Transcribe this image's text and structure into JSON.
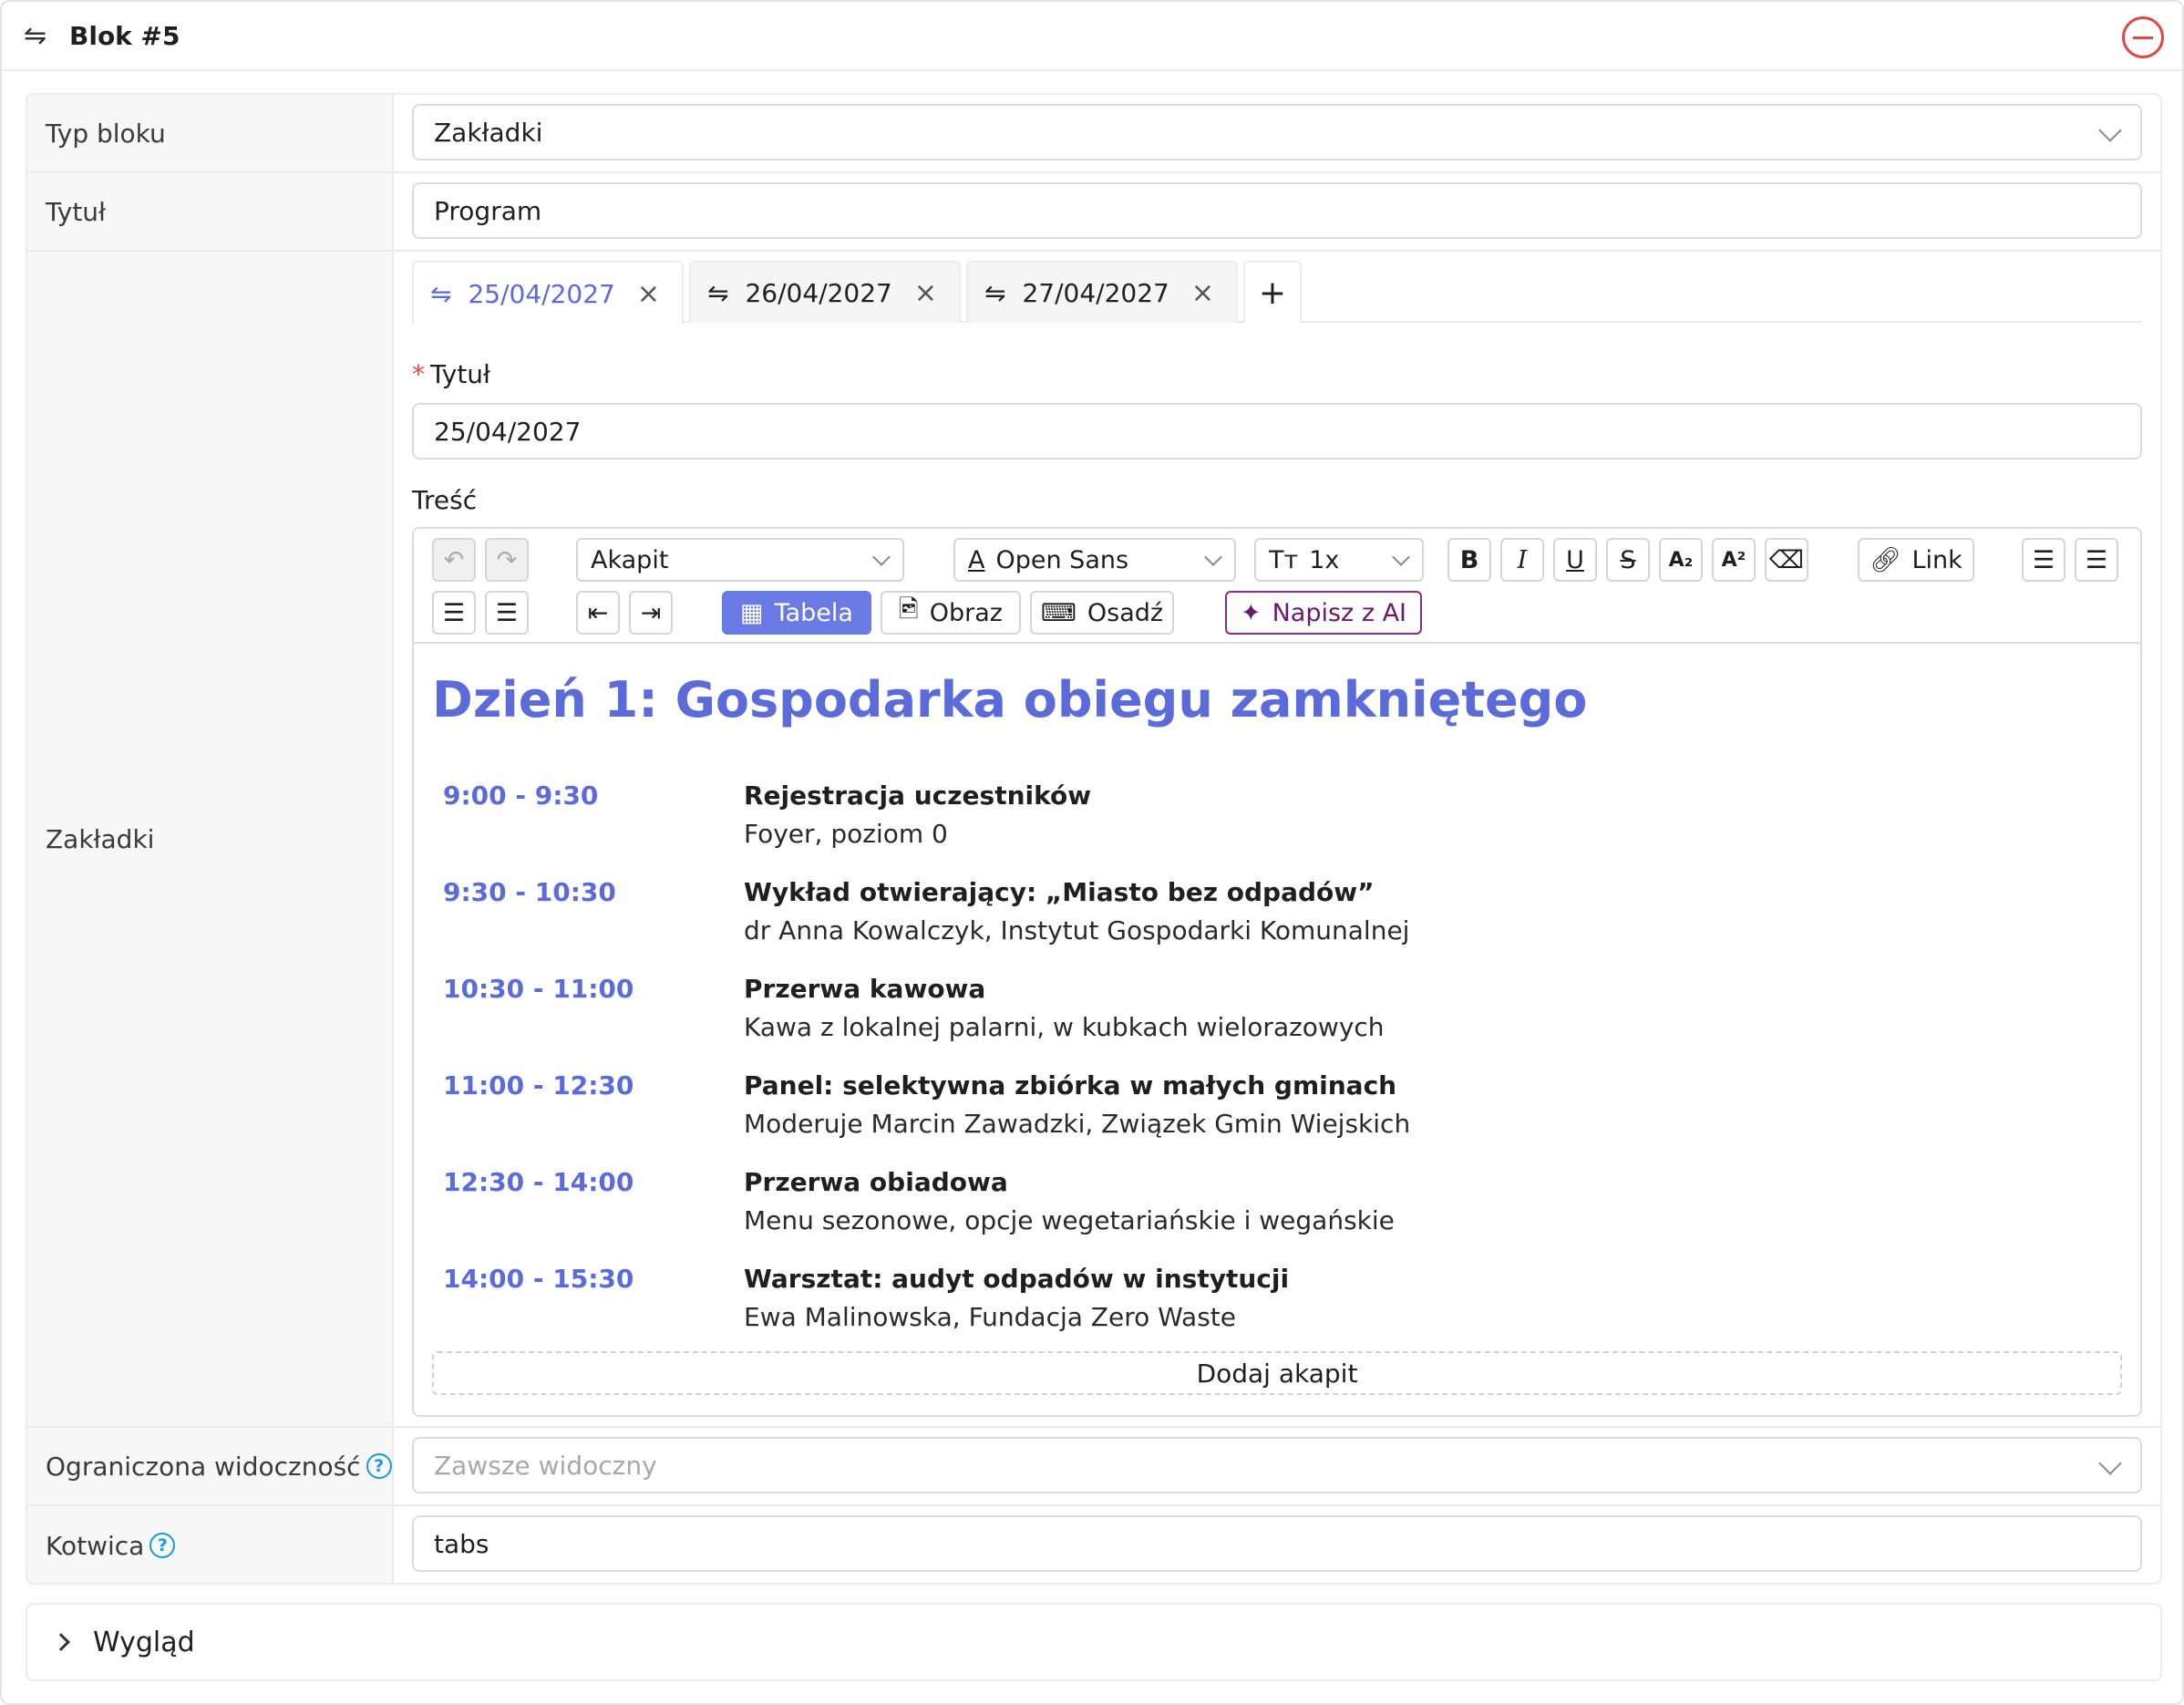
{
  "header": {
    "title": "Blok #5",
    "drag_icon": "swap-icon",
    "remove_icon": "minus-circle-icon"
  },
  "fields": {
    "block_type": {
      "label": "Typ bloku",
      "value": "Zakładki"
    },
    "title": {
      "label": "Tytuł",
      "value": "Program"
    },
    "tabs_label": "Zakładki",
    "visibility": {
      "label": "Ograniczona widoczność",
      "help": "?",
      "placeholder": "Zawsze widoczny"
    },
    "anchor": {
      "label": "Kotwica",
      "help": "?",
      "value": "tabs"
    }
  },
  "tabs": [
    {
      "label": "25/04/2027",
      "active": true
    },
    {
      "label": "26/04/2027",
      "active": false
    },
    {
      "label": "27/04/2027",
      "active": false
    }
  ],
  "tab_form": {
    "required_mark": "*",
    "title_label": "Tytuł",
    "title_value": "25/04/2027",
    "content_label": "Treść"
  },
  "toolbar": {
    "paragraph": "Akapit",
    "font": "Open Sans",
    "font_icon": "A",
    "size": "1x",
    "size_icon": "Tт",
    "bold": "B",
    "italic": "I",
    "underline": "U",
    "strike": "S",
    "subscript": "A₂",
    "superscript": "A²",
    "link": "Link",
    "table": "Tabela",
    "image": "Obraz",
    "embed": "Osadź",
    "ai": "Napisz z AI"
  },
  "content": {
    "heading": "Dzień 1: Gospodarka obiegu zamkniętego",
    "schedule": [
      {
        "time": "9:00 - 9:30",
        "title": "Rejestracja uczestników",
        "desc": "Foyer, poziom 0"
      },
      {
        "time": "9:30 - 10:30",
        "title": "Wykład otwierający: „Miasto bez odpadów”",
        "desc": "dr Anna Kowalczyk, Instytut Gospodarki Komunalnej"
      },
      {
        "time": "10:30 - 11:00",
        "title": "Przerwa kawowa",
        "desc": "Kawa z lokalnej palarni, w kubkach wielorazowych"
      },
      {
        "time": "11:00 - 12:30",
        "title": "Panel: selektywna zbiórka w małych gminach",
        "desc": "Moderuje Marcin Zawadzki, Związek Gmin Wiejskich"
      },
      {
        "time": "12:30 - 14:00",
        "title": "Przerwa obiadowa",
        "desc": "Menu sezonowe, opcje wegetariańskie i wegańskie"
      },
      {
        "time": "14:00 - 15:30",
        "title": "Warsztat: audyt odpadów w instytucji",
        "desc": "Ewa Malinowska, Fundacja Zero Waste"
      }
    ],
    "add_paragraph": "Dodaj akapit"
  },
  "appearance": {
    "label": "Wygląd"
  },
  "colors": {
    "accent": "#5b6bd9",
    "danger": "#e04848",
    "help": "#1a9bd7",
    "ai": "#8a2a8a"
  }
}
